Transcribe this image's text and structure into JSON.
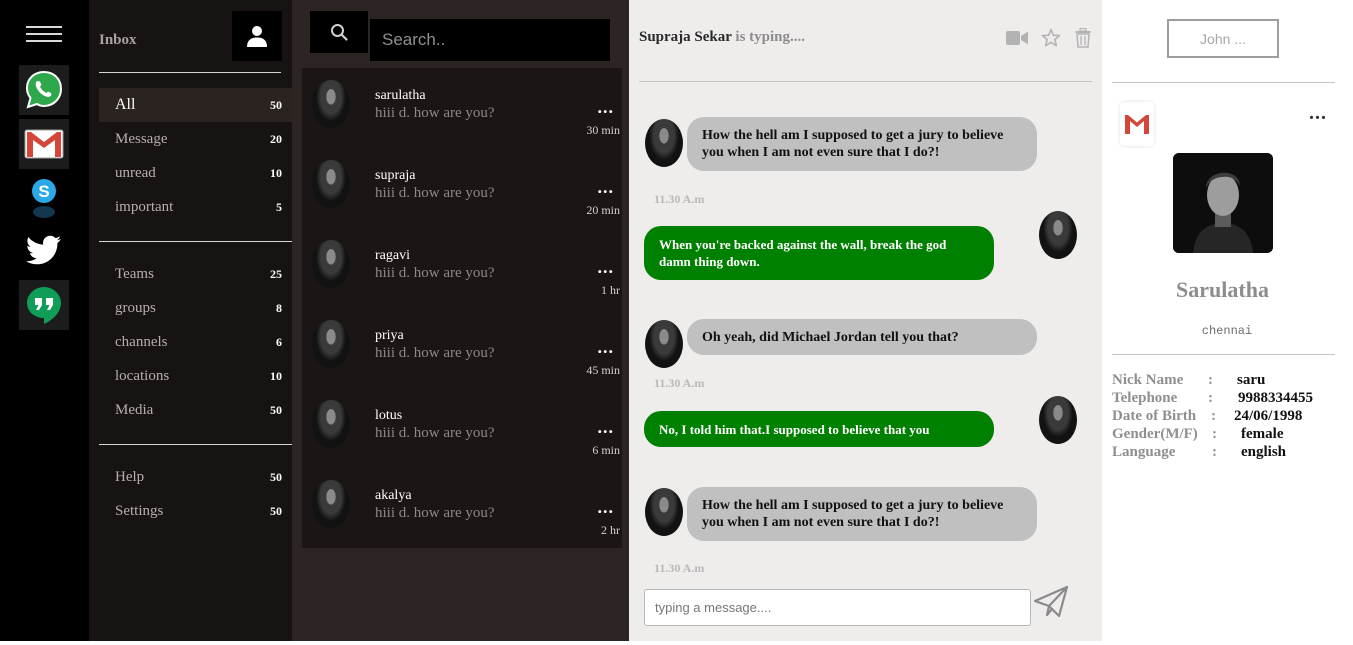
{
  "colors": {
    "rail_bg": "#000000",
    "folder_bg": "#171312",
    "list_bg": "#2d2523",
    "chat_bg": "#efecec",
    "incoming_bubble": "#c0c0c0",
    "outgoing_bubble": "#008000"
  },
  "rail": {
    "menu_icon": "hamburger-icon",
    "apps": [
      {
        "name": "whatsapp",
        "icon": "whatsapp-icon"
      },
      {
        "name": "gmail",
        "icon": "gmail-icon"
      },
      {
        "name": "skype",
        "icon": "skype-icon"
      },
      {
        "name": "twitter",
        "icon": "twitter-icon"
      },
      {
        "name": "hangouts",
        "icon": "hangouts-icon"
      }
    ]
  },
  "folders": {
    "title": "Inbox",
    "profile_icon": "user-icon",
    "groups": [
      [
        {
          "label": "All",
          "count": "50",
          "active": true
        },
        {
          "label": "Message",
          "count": "20"
        },
        {
          "label": "unread",
          "count": "10"
        },
        {
          "label": "important",
          "count": "5"
        }
      ],
      [
        {
          "label": "Teams",
          "count": "25"
        },
        {
          "label": "groups",
          "count": "8"
        },
        {
          "label": "channels",
          "count": "6"
        },
        {
          "label": "locations",
          "count": "10"
        },
        {
          "label": "Media",
          "count": "50"
        }
      ],
      [
        {
          "label": "Help",
          "count": "50"
        },
        {
          "label": "Settings",
          "count": "50"
        }
      ]
    ]
  },
  "search": {
    "placeholder": "Search.."
  },
  "conversations": [
    {
      "name": "sarulatha",
      "preview": "hiii d. how are you?",
      "more": "...",
      "time": "30 min"
    },
    {
      "name": "supraja",
      "preview": "hiii d. how are you?",
      "more": "...",
      "time": "20 min"
    },
    {
      "name": "ragavi",
      "preview": "hiii d. how are you?",
      "more": "...",
      "time": "1 hr"
    },
    {
      "name": "priya",
      "preview": "hiii d. how are you?",
      "more": "...",
      "time": "45 min"
    },
    {
      "name": "lotus",
      "preview": "hiii d. how are you?",
      "more": "...",
      "time": "6 min"
    },
    {
      "name": "akalya",
      "preview": "hiii d. how are you?",
      "more": "...",
      "time": "2 hr"
    }
  ],
  "chat": {
    "contact_name": "Supraja Sekar",
    "status": " is typing....",
    "header_icons": [
      "video-icon",
      "star-icon",
      "trash-icon"
    ],
    "messages": [
      {
        "dir": "in",
        "text": "How the hell am I supposed to get a jury to believe you when I am not even sure that I do?!"
      },
      {
        "dir": "stamp",
        "text": "11.30 A.m"
      },
      {
        "dir": "out",
        "text": "When you're backed against the wall, break the god damn thing down."
      },
      {
        "dir": "in",
        "text": "Oh yeah, did Michael Jordan tell you that?"
      },
      {
        "dir": "stamp",
        "text": "11.30 A.m"
      },
      {
        "dir": "out",
        "text": "No, I told him that.I supposed to believe that you"
      },
      {
        "dir": "in",
        "text": "How the hell am I supposed to get a jury to believe you when I am not even sure that I do?!"
      },
      {
        "dir": "stamp",
        "text": "11.30 A.m"
      }
    ],
    "input_placeholder": "typing a message....",
    "send_icon": "send-icon"
  },
  "contact": {
    "user_button": "John  ...",
    "app_icon": "gmail-icon",
    "more": "...",
    "name": "Sarulatha",
    "city": "chennai",
    "details": [
      {
        "key": "Nick Name",
        "value": "saru"
      },
      {
        "key": "Telephone",
        "value": "9988334455"
      },
      {
        "key": "Date of Birth",
        "value": "24/06/1998"
      },
      {
        "key": "Gender(M/F)",
        "value": "female"
      },
      {
        "key": "Language",
        "value": "english"
      }
    ]
  }
}
